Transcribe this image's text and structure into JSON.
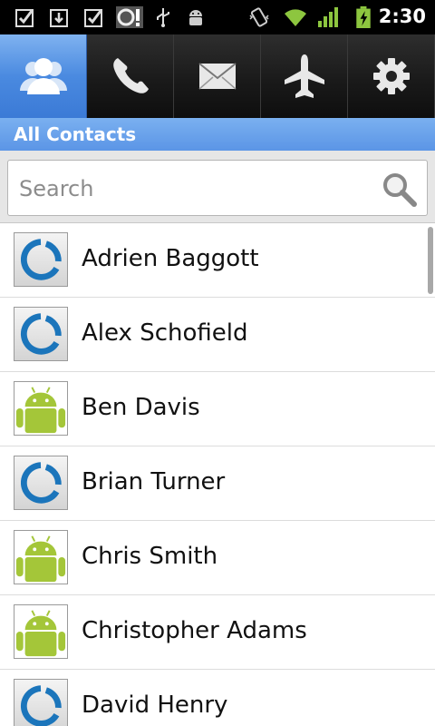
{
  "status_bar": {
    "time": "2:30",
    "icons": [
      "checkbox-icon",
      "download-icon",
      "checkbox-icon",
      "sync-alert-icon",
      "usb-icon",
      "android-debug-icon",
      "vibrate-icon",
      "wifi-icon",
      "signal-icon",
      "battery-charging-icon"
    ]
  },
  "tabs": [
    {
      "icon": "contacts-icon",
      "active": true
    },
    {
      "icon": "phone-icon",
      "active": false
    },
    {
      "icon": "envelope-icon",
      "active": false
    },
    {
      "icon": "airplane-icon",
      "active": false
    },
    {
      "icon": "gear-icon",
      "active": false
    }
  ],
  "header": {
    "title": "All Contacts"
  },
  "search": {
    "placeholder": "Search",
    "value": ""
  },
  "contacts": [
    {
      "name": "Adrien Baggott",
      "avatar": "ring-logo"
    },
    {
      "name": "Alex Schofield",
      "avatar": "ring-logo"
    },
    {
      "name": "Ben Davis",
      "avatar": "android"
    },
    {
      "name": "Brian Turner",
      "avatar": "ring-logo"
    },
    {
      "name": "Chris Smith",
      "avatar": "android"
    },
    {
      "name": "Christopher Adams",
      "avatar": "android"
    },
    {
      "name": "David Henry",
      "avatar": "ring-logo"
    }
  ],
  "colors": {
    "accent": "#4a8ae0",
    "title_bar": "#6aa2eb",
    "android_green": "#a4c639",
    "ring_blue": "#1b75bb"
  }
}
